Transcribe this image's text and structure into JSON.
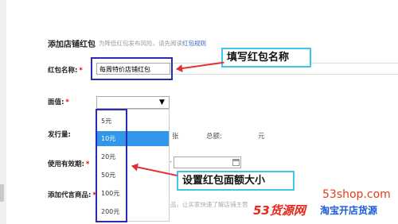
{
  "header": {
    "title": "添加店铺红包",
    "hint_prefix": "为降低红包发布风险，请先阅读",
    "hint_link": "红包规则"
  },
  "form": {
    "name_label": "红包名称:",
    "name_value": "每周特价店铺红包",
    "value_label": "面值:",
    "issue_label": "发行量:",
    "issue_unit": "张",
    "total_label": "总额:",
    "total_unit": "元",
    "valid_label": "使用有效期:",
    "valid_dash": "-",
    "product_label": "添加代言商品:",
    "product_hint": "品，让买家快速了解店铺主营",
    "required_mark": "*"
  },
  "dropdown": {
    "options": [
      "5元",
      "10元",
      "20元",
      "50元",
      "100元",
      "200元"
    ],
    "selected_index": 1
  },
  "annotations": {
    "name_callout": "填写红包名称",
    "value_callout": "设置红包面额大小"
  },
  "watermark": {
    "site": "53shop.com",
    "brand": "53货源网",
    "slogan": "淘宝开店货源"
  },
  "colors": {
    "highlight_border": "#2a2ab8",
    "callout_border": "#3fc5e8",
    "arrow": "#e23030",
    "selected_option": "#3296ea",
    "link": "#3a66c4"
  }
}
